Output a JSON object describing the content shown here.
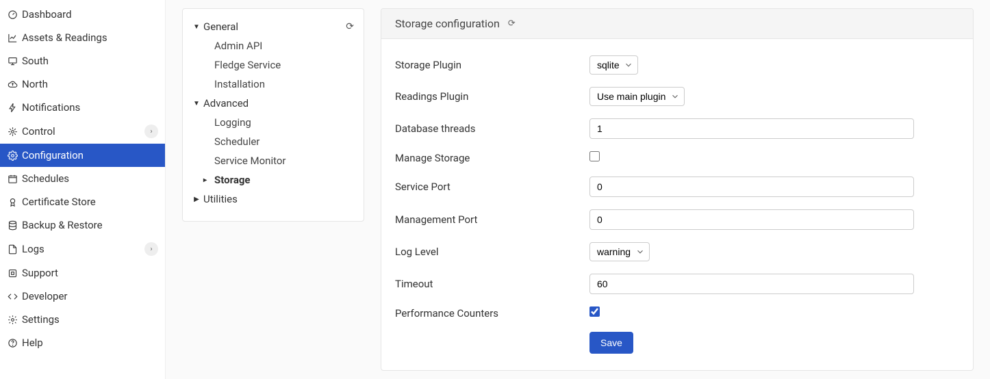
{
  "sidebar": {
    "items": [
      {
        "label": "Dashboard",
        "icon": "dashboard"
      },
      {
        "label": "Assets & Readings",
        "icon": "chart"
      },
      {
        "label": "South",
        "icon": "desktop"
      },
      {
        "label": "North",
        "icon": "cloud-up"
      },
      {
        "label": "Notifications",
        "icon": "bolt"
      },
      {
        "label": "Control",
        "icon": "spider",
        "expandable": true
      },
      {
        "label": "Configuration",
        "icon": "gear",
        "active": true
      },
      {
        "label": "Schedules",
        "icon": "calendar"
      },
      {
        "label": "Certificate Store",
        "icon": "cert"
      },
      {
        "label": "Backup & Restore",
        "icon": "db"
      },
      {
        "label": "Logs",
        "icon": "doc",
        "expandable": true
      },
      {
        "label": "Support",
        "icon": "life"
      },
      {
        "label": "Developer",
        "icon": "code"
      },
      {
        "label": "Settings",
        "icon": "gear"
      },
      {
        "label": "Help",
        "icon": "help"
      }
    ]
  },
  "tree": {
    "sections": [
      {
        "label": "General",
        "expanded": true,
        "items": [
          {
            "label": "Admin API"
          },
          {
            "label": "Fledge Service"
          },
          {
            "label": "Installation"
          }
        ]
      },
      {
        "label": "Advanced",
        "expanded": true,
        "items": [
          {
            "label": "Logging"
          },
          {
            "label": "Scheduler"
          },
          {
            "label": "Service Monitor"
          },
          {
            "label": "Storage",
            "active": true
          }
        ]
      },
      {
        "label": "Utilities",
        "expanded": false,
        "items": []
      }
    ]
  },
  "form": {
    "title": "Storage configuration",
    "fields": {
      "storage_plugin": {
        "label": "Storage Plugin",
        "value": "sqlite"
      },
      "readings_plugin": {
        "label": "Readings Plugin",
        "value": "Use main plugin"
      },
      "database_threads": {
        "label": "Database threads",
        "value": "1"
      },
      "manage_storage": {
        "label": "Manage Storage",
        "value": false
      },
      "service_port": {
        "label": "Service Port",
        "value": "0"
      },
      "management_port": {
        "label": "Management Port",
        "value": "0"
      },
      "log_level": {
        "label": "Log Level",
        "value": "warning"
      },
      "timeout": {
        "label": "Timeout",
        "value": "60"
      },
      "performance_counters": {
        "label": "Performance Counters",
        "value": true
      }
    },
    "save_label": "Save"
  }
}
